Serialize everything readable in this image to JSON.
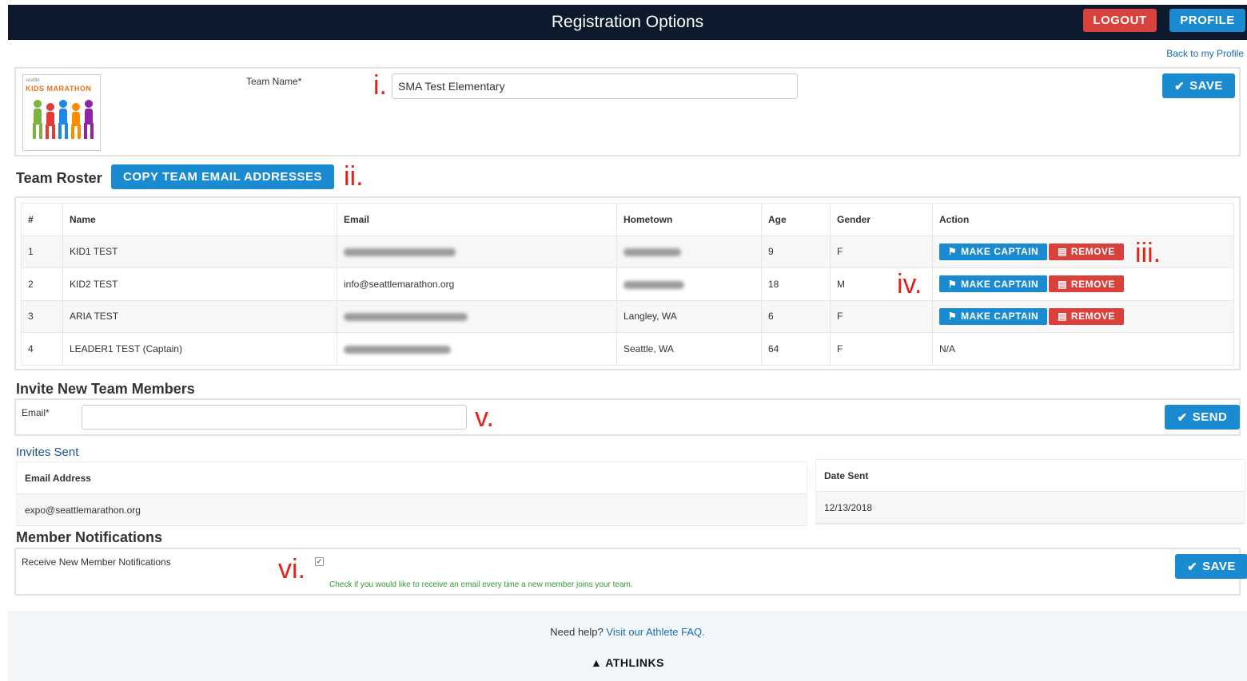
{
  "header": {
    "title": "Registration Options",
    "logout_label": "LOGOUT",
    "profile_label": "PROFILE"
  },
  "back_link": "Back to my Profile",
  "team": {
    "logo_text_top": "seattle",
    "logo_text_main": "KIDS MARATHON",
    "name_label": "Team Name*",
    "name_value": "SMA Test Elementary",
    "save_label": "SAVE"
  },
  "roster": {
    "title": "Team Roster",
    "copy_label": "COPY TEAM EMAIL ADDRESSES",
    "columns": [
      "#",
      "Name",
      "Email",
      "Hometown",
      "Age",
      "Gender",
      "Action"
    ],
    "rows": [
      {
        "num": "1",
        "name": "KID1 TEST",
        "email": "",
        "hometown": "",
        "age": "9",
        "gender": "F",
        "action": "buttons"
      },
      {
        "num": "2",
        "name": "KID2 TEST",
        "email": "info@seattlemarathon.org",
        "hometown": "",
        "age": "18",
        "gender": "M",
        "action": "buttons"
      },
      {
        "num": "3",
        "name": "ARIA TEST",
        "email": "",
        "hometown": "Langley, WA",
        "age": "6",
        "gender": "F",
        "action": "buttons"
      },
      {
        "num": "4",
        "name": "LEADER1 TEST (Captain)",
        "email": "",
        "hometown": "Seattle, WA",
        "age": "64",
        "gender": "F",
        "action": "N/A"
      }
    ],
    "make_captain_label": "MAKE CAPTAIN",
    "remove_label": "REMOVE"
  },
  "invite": {
    "title": "Invite New Team Members",
    "email_label": "Email*",
    "email_value": "",
    "send_label": "SEND"
  },
  "invites_sent": {
    "title": "Invites Sent",
    "col_email": "Email Address",
    "col_date": "Date Sent",
    "email": "expo@seattlemarathon.org",
    "date": "12/13/2018"
  },
  "notifications": {
    "title": "Member Notifications",
    "label": "Receive New Member Notifications",
    "checked": true,
    "hint": "Check if you would like to receive an email every time a new member joins your team.",
    "save_label": "SAVE"
  },
  "annotations": {
    "a1": "i.",
    "a2": "ii.",
    "a3": "iii.",
    "a4": "iv.",
    "a5": "v.",
    "a6": "vi."
  },
  "footer": {
    "help_text": "Need help?",
    "help_link": "Visit our Athlete FAQ.",
    "brand": "ATHLINKS"
  },
  "colors": {
    "header_bg": "#0d1a2e",
    "primary": "#1a8bd1",
    "danger": "#d9413c",
    "annotation": "#e02419",
    "hint": "#2e9d2e"
  }
}
